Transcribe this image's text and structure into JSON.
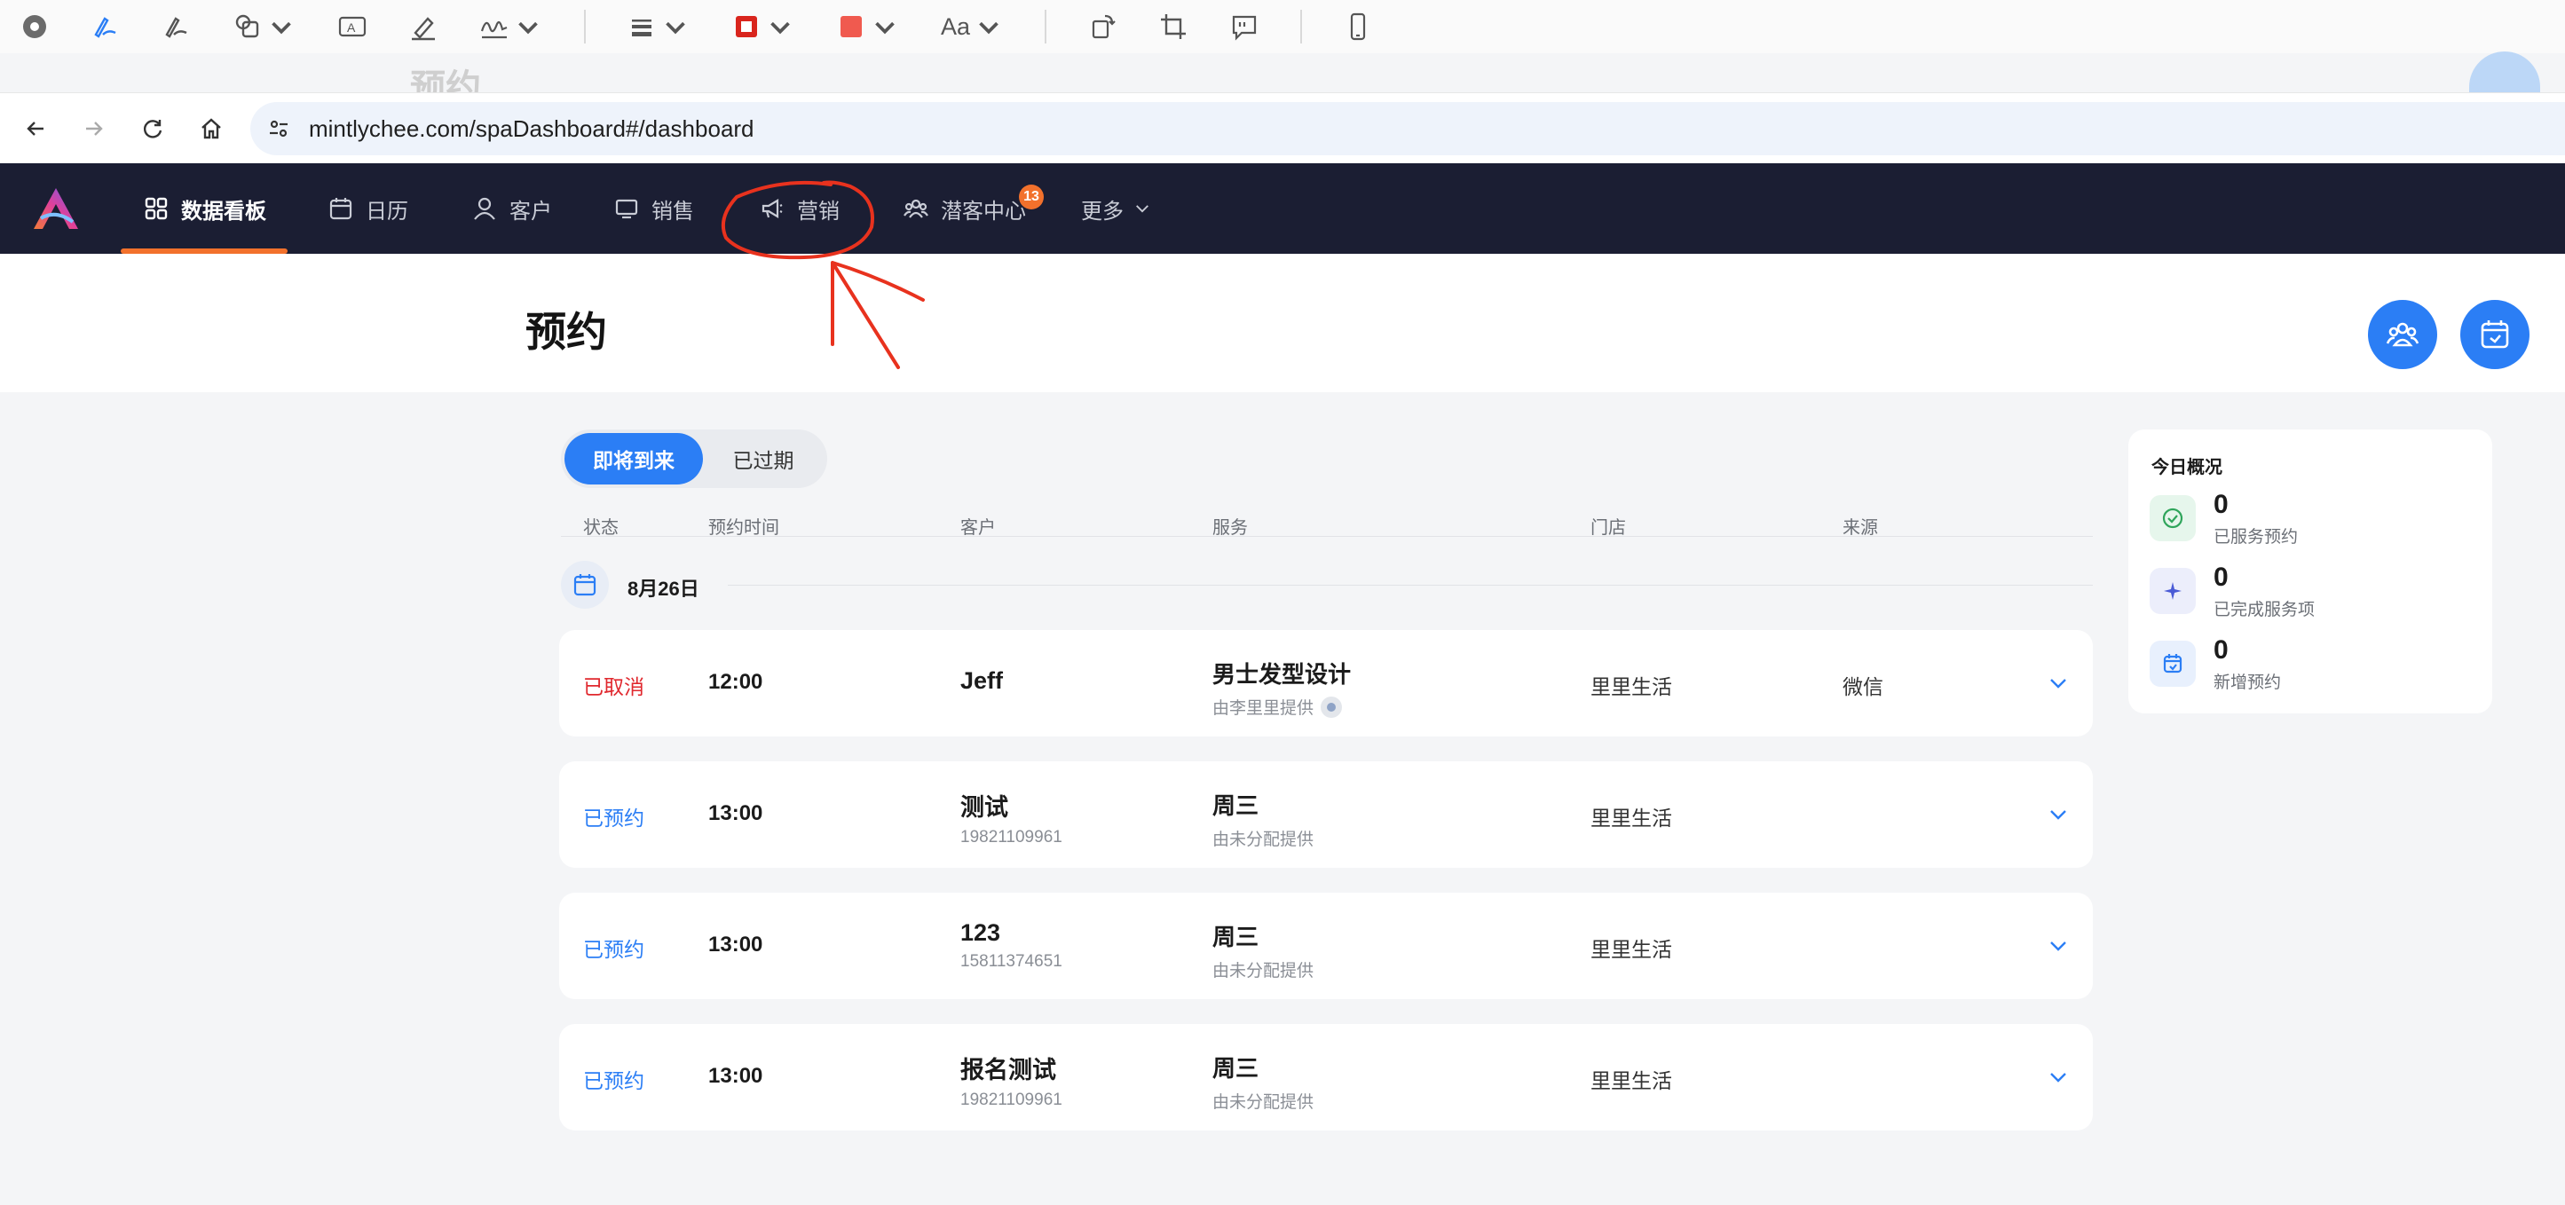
{
  "browser": {
    "url": "mintlychee.com/spaDashboard#/dashboard"
  },
  "background_page": {
    "faded_title": "预约"
  },
  "markup_toolbar": {
    "font_label": "Aa",
    "tools": [
      "record-icon",
      "sketch-pen-icon",
      "draw-pen-icon",
      "shapes-icon",
      "text-box-icon",
      "highlighter-icon",
      "signature-icon",
      "line-style-icon",
      "border-color-icon",
      "fill-color-icon",
      "font-icon",
      "rotate-icon",
      "crop-icon",
      "annotate-icon",
      "device-icon"
    ]
  },
  "nav": {
    "items": [
      {
        "label": "数据看板",
        "icon": "grid-icon",
        "active": true
      },
      {
        "label": "日历",
        "icon": "calendar-icon"
      },
      {
        "label": "客户",
        "icon": "person-icon"
      },
      {
        "label": "销售",
        "icon": "monitor-icon"
      },
      {
        "label": "营销",
        "icon": "megaphone-icon"
      },
      {
        "label": "潜客中心",
        "icon": "people-icon",
        "badge": "13"
      },
      {
        "label": "更多",
        "icon": "chevron-down-icon"
      }
    ]
  },
  "page": {
    "title": "预约"
  },
  "tabs": {
    "upcoming": "即将到来",
    "expired": "已过期"
  },
  "table": {
    "headers": {
      "status": "状态",
      "time": "预约时间",
      "customer": "客户",
      "service": "服务",
      "store": "门店",
      "source": "来源"
    },
    "group_date": "8月26日",
    "rows": [
      {
        "status": "已取消",
        "time": "12:00",
        "customer": "Jeff",
        "phone": "",
        "service": "男士发型设计",
        "provider": "由李里里提供",
        "store": "里里生活",
        "source": "微信"
      },
      {
        "status": "已预约",
        "time": "13:00",
        "customer": "测试",
        "phone": "19821109961",
        "service": "周三",
        "provider": "由未分配提供",
        "store": "里里生活",
        "source": ""
      },
      {
        "status": "已预约",
        "time": "13:00",
        "customer": "123",
        "phone": "15811374651",
        "service": "周三",
        "provider": "由未分配提供",
        "store": "里里生活",
        "source": ""
      },
      {
        "status": "已预约",
        "time": "13:00",
        "customer": "报名测试",
        "phone": "19821109961",
        "service": "周三",
        "provider": "由未分配提供",
        "store": "里里生活",
        "source": ""
      }
    ]
  },
  "overview": {
    "title": "今日概况",
    "stats": [
      {
        "value": "0",
        "label": "已服务预约",
        "icon": "check-circle-icon"
      },
      {
        "value": "0",
        "label": "已完成服务项",
        "icon": "sparkle-icon"
      },
      {
        "value": "0",
        "label": "新增预约",
        "icon": "calendar-add-icon"
      }
    ]
  },
  "colors": {
    "nav_bg": "#1b1e33",
    "accent": "#2b7ef5",
    "active_underline": "#f2712c",
    "cancel": "#e0282e",
    "annotation": "#e8321e"
  }
}
